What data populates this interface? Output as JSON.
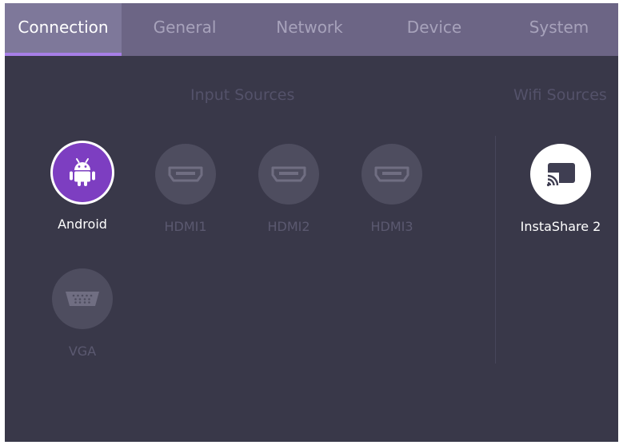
{
  "tabs": [
    {
      "label": "Connection",
      "active": true
    },
    {
      "label": "General",
      "active": false
    },
    {
      "label": "Network",
      "active": false
    },
    {
      "label": "Device",
      "active": false
    },
    {
      "label": "System",
      "active": false
    }
  ],
  "input_sources": {
    "title": "Input Sources",
    "items": [
      {
        "label": "Android",
        "icon": "android-icon",
        "active": true
      },
      {
        "label": "HDMI1",
        "icon": "hdmi-icon",
        "active": false
      },
      {
        "label": "HDMI2",
        "icon": "hdmi-icon",
        "active": false
      },
      {
        "label": "HDMI3",
        "icon": "hdmi-icon",
        "active": false
      },
      {
        "label": "VGA",
        "icon": "vga-icon",
        "active": false
      }
    ]
  },
  "wifi_sources": {
    "title": "Wifi Sources",
    "items": [
      {
        "label": "InstaShare 2",
        "icon": "cast-icon",
        "active": true
      }
    ]
  },
  "colors": {
    "background": "#393849",
    "tabbar": "#6c6585",
    "tab_active": "#7e789a",
    "accent": "#a77fe6",
    "android_active": "#7d3ec1",
    "inactive_circle": "#4e4d5f"
  }
}
